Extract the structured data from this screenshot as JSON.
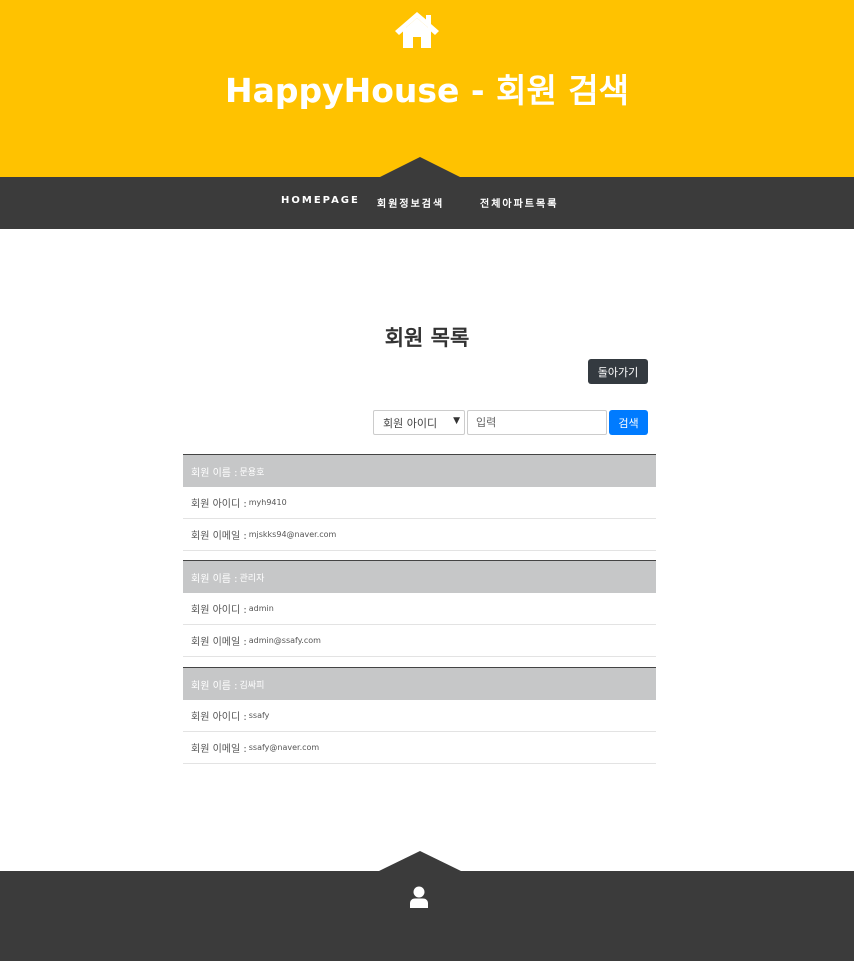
{
  "header": {
    "icon": "home-icon",
    "title": "HappyHouse - 회원 검색"
  },
  "nav": {
    "items": [
      {
        "label": "HOMEPAGE"
      },
      {
        "label": "회원정보검색"
      },
      {
        "label": "전체아파트목록"
      }
    ]
  },
  "main": {
    "title": "회원 목록",
    "back_label": "돌아가기",
    "search": {
      "select_value": "회원 아이디",
      "placeholder": "입력",
      "button_label": "검색"
    },
    "members": [
      {
        "name_label": "회원 이름 :",
        "name": "문용호",
        "id_label": "회원 아이디 :",
        "id": "myh9410",
        "email_label": "회원 이메일 :",
        "email": "mjskks94@naver.com"
      },
      {
        "name_label": "회원 이름 :",
        "name": "관리자",
        "id_label": "회원 아이디 :",
        "id": "admin",
        "email_label": "회원 이메일 :",
        "email": "admin@ssafy.com"
      },
      {
        "name_label": "회원 이름 :",
        "name": "김싸피",
        "id_label": "회원 아이디 :",
        "id": "ssafy",
        "email_label": "회원 이메일 :",
        "email": "ssafy@naver.com"
      }
    ]
  },
  "footer": {
    "icon": "user-icon"
  },
  "colors": {
    "header_bg": "#ffc200",
    "nav_bg": "#3b3b3b",
    "button_dark": "#343a40",
    "button_primary": "#007bff",
    "card_head_bg": "#c6c7c8"
  }
}
